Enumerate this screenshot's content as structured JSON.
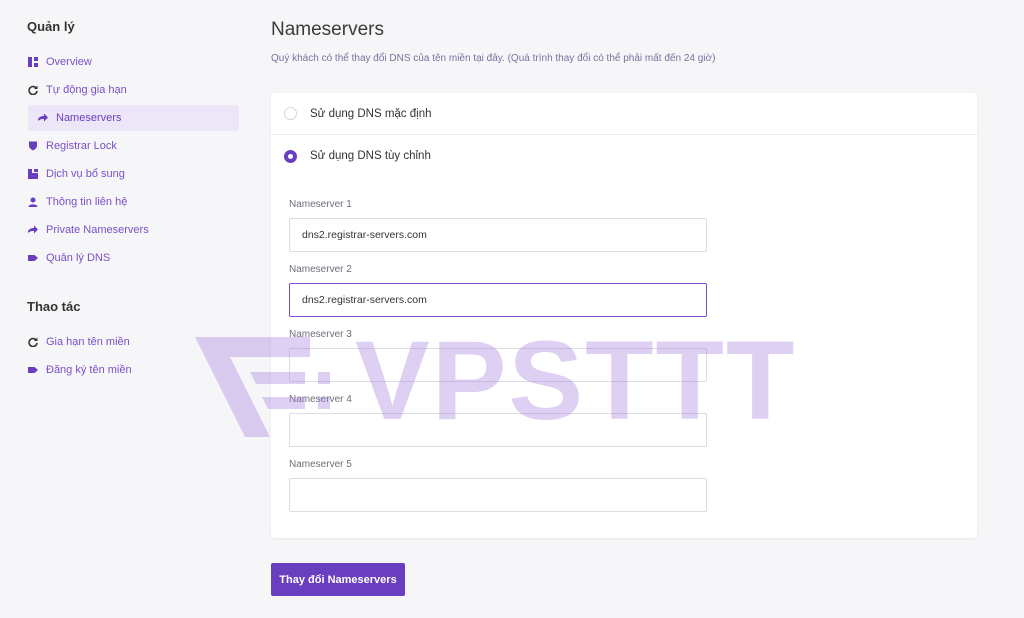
{
  "sidebar": {
    "manage_title": "Quản lý",
    "manage_items": [
      {
        "label": "Overview",
        "icon": "grid-icon"
      },
      {
        "label": "Tự động gia hạn",
        "icon": "refresh-icon"
      },
      {
        "label": "Nameservers",
        "icon": "arrow-right-icon"
      },
      {
        "label": "Registrar Lock",
        "icon": "shield-icon"
      },
      {
        "label": "Dịch vụ bổ sung",
        "icon": "addon-icon"
      },
      {
        "label": "Thông tin liên hệ",
        "icon": "user-icon"
      },
      {
        "label": "Private Nameservers",
        "icon": "arrow-right-icon"
      },
      {
        "label": "Quản lý DNS",
        "icon": "tag-icon"
      }
    ],
    "actions_title": "Thao tác",
    "action_items": [
      {
        "label": "Gia hạn tên miền",
        "icon": "refresh-icon"
      },
      {
        "label": "Đăng ký tên miền",
        "icon": "tag-icon"
      }
    ],
    "active_item": "Nameservers"
  },
  "main": {
    "title": "Nameservers",
    "description": "Quý khách có thể thay đổi DNS của tên miền tại đây. (Quá trình thay đổi có thể phải mất đến 24 giờ)",
    "option_default": "Sử dụng DNS mặc định",
    "option_custom": "Sử dụng DNS tùy chỉnh",
    "selected_option": "custom",
    "nameservers": [
      {
        "label": "Nameserver 1",
        "value": "dns2.registrar-servers.com"
      },
      {
        "label": "Nameserver 2",
        "value": "dns2.registrar-servers.com"
      },
      {
        "label": "Nameserver 3",
        "value": ""
      },
      {
        "label": "Nameserver 4",
        "value": ""
      },
      {
        "label": "Nameserver 5",
        "value": ""
      }
    ],
    "submit_label": "Thay đổi Nameservers"
  },
  "watermark": "VPSTTT",
  "colors": {
    "accent": "#6a3fbf",
    "link": "#7b4fc8",
    "background": "#f6f6f9",
    "active_bg": "#ece6f8"
  }
}
